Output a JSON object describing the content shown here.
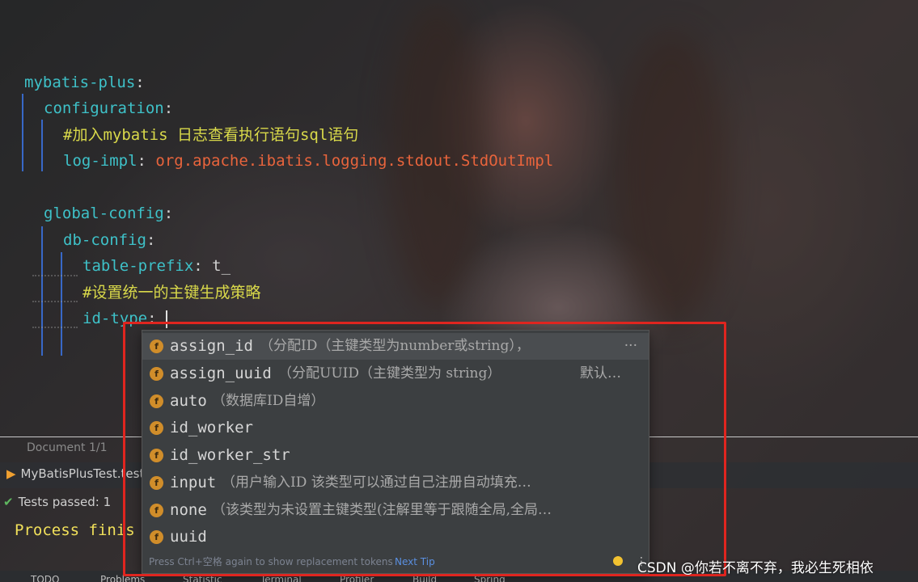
{
  "editor": {
    "lines": [
      {
        "key": "mybatis-plus",
        "punct": ":"
      },
      {
        "key": "configuration",
        "punct": ":"
      },
      {
        "comment": "#加入mybatis 日志查看执行语句sql语句"
      },
      {
        "key": "log-impl",
        "punct": ": ",
        "value": "org.apache.ibatis.logging.stdout.StdOutImpl"
      },
      {
        "key": "global-config",
        "punct": ":"
      },
      {
        "key": "db-config",
        "punct": ":"
      },
      {
        "key": "table-prefix",
        "punct": ": ",
        "plain": "t_"
      },
      {
        "comment": "#设置统一的主键生成策略"
      },
      {
        "key": "id-type",
        "punct": ":"
      }
    ]
  },
  "completion": {
    "items": [
      {
        "name": "assign_id",
        "desc": "（分配ID（主键类型为number或string），",
        "right": "···",
        "selected": true
      },
      {
        "name": "assign_uuid",
        "desc": "（分配UUID（主键类型为 string）",
        "right": "默认…",
        "selected": false
      },
      {
        "name": "auto",
        "desc": "（数据库ID自增）",
        "right": "",
        "selected": false
      },
      {
        "name": "id_worker",
        "desc": "",
        "right": "",
        "selected": false
      },
      {
        "name": "id_worker_str",
        "desc": "",
        "right": "",
        "selected": false
      },
      {
        "name": "input",
        "desc": "（用户输入ID      该类型可以通过自己注册自动填充…",
        "right": "",
        "selected": false
      },
      {
        "name": "none",
        "desc": "（该类型为未设置主键类型(注解里等于跟随全局,全局…",
        "right": "",
        "selected": false
      },
      {
        "name": "uuid",
        "desc": "",
        "right": "",
        "selected": false
      }
    ],
    "icon_letter": "f",
    "footer_hint": "Press Ctrl+空格  again to show replacement tokens",
    "footer_tip": "Next Tip"
  },
  "status": {
    "document": "Document 1/1",
    "run_tab": "MyBatisPlusTest.test",
    "tests": "Tests passed: 1",
    "process": "Process finis"
  },
  "toolbar": [
    "TODO",
    "Problems",
    "Statistic",
    "Terminal",
    "Profiler",
    "Build",
    "Spring"
  ],
  "watermark": "CSDN @你若不离不弃，我必生死相依",
  "colors": {
    "key": "#3ec1c8",
    "string": "#e8643c",
    "comment": "#d9d94a",
    "highlight_box": "#e0251f",
    "accent_icon": "#d08d2a"
  }
}
